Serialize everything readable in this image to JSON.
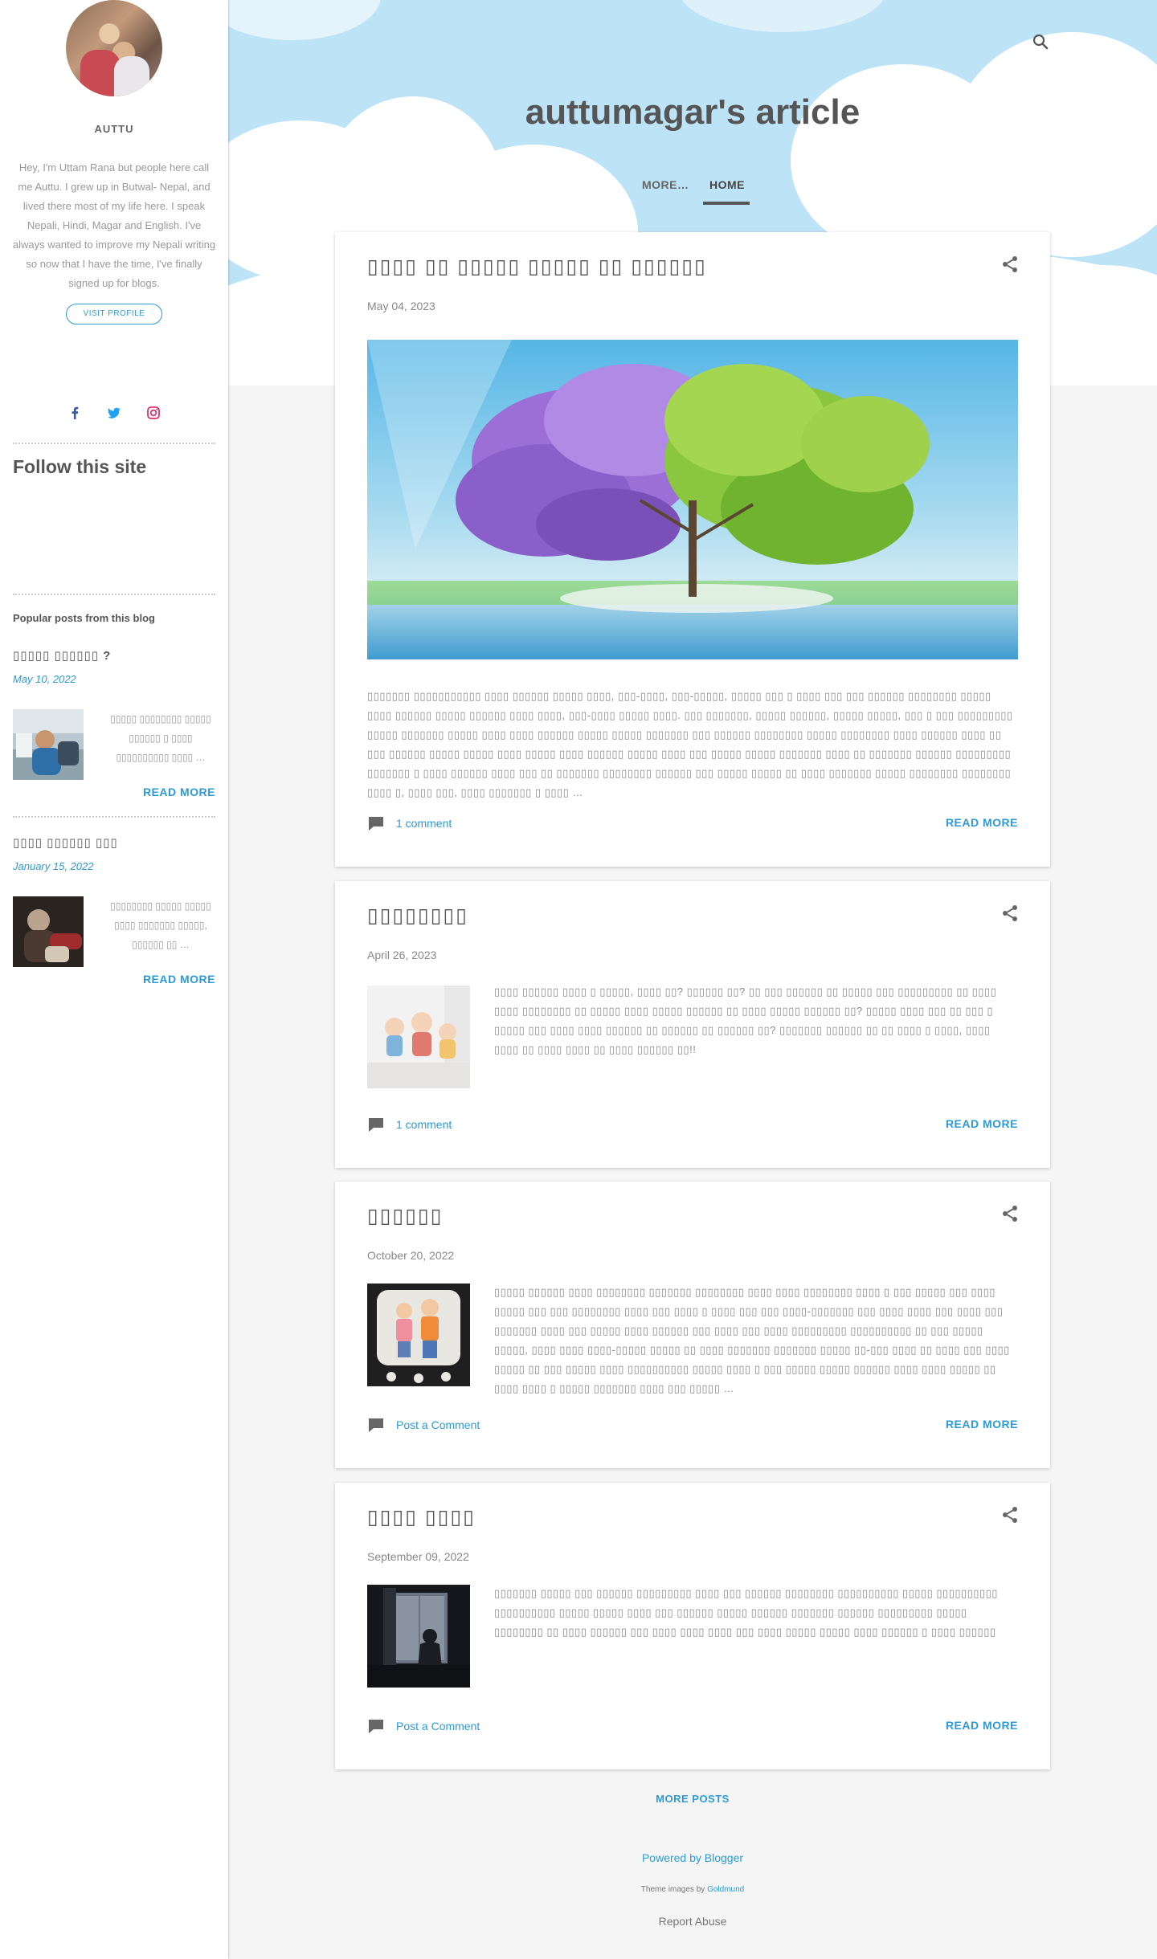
{
  "blog": {
    "title": "auttumagar's article"
  },
  "nav": {
    "more_label": "MORE…",
    "home_label": "HOME"
  },
  "profile": {
    "name": "AUTTU",
    "bio": "Hey, I'm Uttam Rana but people here call me Auttu. I grew up in Butwal- Nepal, and lived there most of my life here. I speak Nepali, Hindi, Magar and English. I've always wanted to improve my Nepali writing so now that I have the time, I've finally signed up for blogs.",
    "visit_profile_label": "VISIT PROFILE",
    "social_icons": [
      "facebook-icon",
      "twitter-icon",
      "instagram-icon"
    ]
  },
  "sidebar": {
    "follow_title": "Follow this site",
    "popular_title": "Popular posts from this blog",
    "popular_posts": [
      {
        "title": "▯▯▯▯▯ ▯▯▯▯▯▯ ?",
        "date": "May 10, 2022",
        "snippet": "▯▯▯▯▯ ▯▯▯▯▯▯▯▯ ▯▯▯▯▯ ▯▯▯▯▯▯ ▯ ▯▯▯▯ ▯▯▯▯▯▯▯▯▯▯ ▯▯▯▯ …",
        "read_more_label": "READ MORE"
      },
      {
        "title": "▯▯▯▯ ▯▯▯▯▯▯ ▯▯▯",
        "date": "January 15, 2022",
        "snippet": "▯▯▯▯▯▯▯▯ ▯▯▯▯▯ ▯▯▯▯▯ ▯▯▯▯ ▯▯▯▯▯▯▯ ▯▯▯▯▯, ▯▯▯▯▯▯ ▯▯ …",
        "read_more_label": "READ MORE"
      }
    ]
  },
  "posts": [
    {
      "title": "▯▯▯▯ ▯▯ ▯▯▯▯▯ ▯▯▯▯▯ ▯▯ ▯▯▯▯▯▯",
      "date": "May 04, 2023",
      "snippet": "▯▯▯▯▯▯▯ ▯▯▯▯▯▯▯▯▯▯▯ ▯▯▯▯ ▯▯▯▯▯▯ ▯▯▯▯▯ ▯▯▯▯, ▯▯▯-▯▯▯▯, ▯▯▯-▯▯▯▯▯, ▯▯▯▯▯ ▯▯▯ ▯ ▯▯▯▯ ▯▯▯ ▯▯▯ ▯▯▯▯▯▯ ▯▯▯▯▯▯▯▯ ▯▯▯▯▯ ▯▯▯▯ ▯▯▯▯▯▯ ▯▯▯▯▯ ▯▯▯▯▯▯ ▯▯▯▯ ▯▯▯▯, ▯▯▯-▯▯▯▯ ▯▯▯▯▯ ▯▯▯▯. ▯▯▯ ▯▯▯▯▯▯▯, ▯▯▯▯▯ ▯▯▯▯▯▯, ▯▯▯▯▯ ▯▯▯▯▯, ▯▯▯ ▯ ▯▯▯ ▯▯▯▯▯▯▯▯▯ ▯▯▯▯▯ ▯▯▯▯▯▯▯ ▯▯▯▯▯ ▯▯▯▯ ▯▯▯▯ ▯▯▯▯▯▯ ▯▯▯▯▯ ▯▯▯▯▯ ▯▯▯▯▯▯▯ ▯▯▯ ▯▯▯▯▯▯ ▯▯▯▯▯▯▯▯ ▯▯▯▯▯ ▯▯▯▯▯▯▯▯ ▯▯▯▯ ▯▯▯▯▯▯ ▯▯▯▯ ▯▯ ▯▯▯ ▯▯▯▯▯▯ ▯▯▯▯▯ ▯▯▯▯▯ ▯▯▯▯ ▯▯▯▯▯ ▯▯▯▯ ▯▯▯▯▯▯ ▯▯▯▯▯ ▯▯▯▯ ▯▯▯ ▯▯▯▯▯ ▯▯▯▯▯ ▯▯▯▯▯▯▯ ▯▯▯▯ ▯▯ ▯▯▯▯▯▯▯ ▯▯▯▯▯▯ ▯▯▯▯▯▯▯▯▯ ▯▯▯▯▯▯▯ ▯ ▯▯▯▯ ▯▯▯▯▯▯ ▯▯▯▯ ▯▯▯ ▯▯ ▯▯▯▯▯▯▯ ▯▯▯▯▯▯▯▯ ▯▯▯▯▯▯ ▯▯▯ ▯▯▯▯▯ ▯▯▯▯▯ ▯▯ ▯▯▯▯ ▯▯▯▯▯▯▯ ▯▯▯▯▯ ▯▯▯▯▯▯▯▯ ▯▯▯▯▯▯▯▯ ▯▯▯▯ ▯, ▯▯▯▯ ▯▯▯, ▯▯▯▯ ▯▯▯▯▯▯▯ ▯ ▯▯▯▯ …",
      "comments_label": "1 comment",
      "read_more_label": "READ MORE"
    },
    {
      "title": "▯▯▯▯▯▯▯▯",
      "date": "April 26, 2023",
      "snippet": "▯▯▯▯ ▯▯▯▯▯▯ ▯▯▯▯ ▯ ▯▯▯▯▯, ▯▯▯▯ ▯▯? ▯▯▯▯▯▯ ▯▯?  ▯▯ ▯▯▯ ▯▯▯▯▯▯ ▯▯ ▯▯▯▯▯ ▯▯▯ ▯▯▯▯▯▯▯▯▯ ▯▯ ▯▯▯▯ ▯▯▯▯ ▯▯▯▯▯▯▯▯ ▯▯ ▯▯▯▯▯ ▯▯▯▯ ▯▯▯▯▯ ▯▯▯▯▯▯ ▯▯ ▯▯▯▯ ▯▯▯▯▯ ▯▯▯▯▯▯ ▯▯? ▯▯▯▯▯ ▯▯▯▯ ▯▯▯ ▯▯ ▯▯▯ ▯ ▯▯▯▯▯ ▯▯▯  ▯▯▯▯ ▯▯▯▯ ▯▯▯▯▯▯ ▯▯ ▯▯▯▯▯▯ ▯▯ ▯▯▯▯▯▯ ▯▯? ▯▯▯▯▯▯▯ ▯▯▯▯▯▯ ▯▯ ▯▯ ▯▯▯▯ ▯ ▯▯▯▯,  ▯▯▯▯ ▯▯▯▯ ▯▯ ▯▯▯▯ ▯▯▯▯ ▯▯ ▯▯▯▯ ▯▯▯▯▯▯ ▯▯!!",
      "comments_label": "1 comment",
      "read_more_label": "READ MORE"
    },
    {
      "title": "▯▯▯▯▯▯",
      "date": "October 20, 2022",
      "snippet": "▯▯▯▯▯ ▯▯▯▯▯▯ ▯▯▯▯ ▯▯▯▯▯▯▯▯ ▯▯▯▯▯▯▯ ▯▯▯▯▯▯▯▯ ▯▯▯▯ ▯▯▯▯ ▯▯▯▯▯▯▯▯ ▯▯▯▯ ▯ ▯▯▯ ▯▯▯▯▯ ▯▯▯ ▯▯▯▯ ▯▯▯▯▯ ▯▯▯ ▯▯▯ ▯▯▯▯▯▯▯▯ ▯▯▯▯ ▯▯▯ ▯▯▯▯ ▯ ▯▯▯▯ ▯▯▯ ▯▯▯ ▯▯▯▯-▯▯▯▯▯▯▯ ▯▯▯ ▯▯▯▯ ▯▯▯▯ ▯▯▯ ▯▯▯▯ ▯▯▯ ▯▯▯▯▯▯▯ ▯▯▯▯ ▯▯▯ ▯▯▯▯▯ ▯▯▯▯ ▯▯▯▯▯▯ ▯▯▯ ▯▯▯▯ ▯▯▯ ▯▯▯▯ ▯▯▯▯▯▯▯▯▯ ▯▯▯▯▯▯▯▯▯▯ ▯▯ ▯▯▯ ▯▯▯▯▯ ▯▯▯▯▯, ▯▯▯▯ ▯▯▯▯ ▯▯▯▯-▯▯▯▯▯ ▯▯▯▯▯ ▯▯ ▯▯▯▯ ▯▯▯▯▯▯▯ ▯▯▯▯▯▯▯ ▯▯▯▯▯ ▯▯-▯▯▯ ▯▯▯▯ ▯▯ ▯▯▯▯ ▯▯▯ ▯▯▯▯ ▯▯▯▯▯ ▯▯ ▯▯▯ ▯▯▯▯▯ ▯▯▯▯ ▯▯▯▯▯▯▯▯▯▯   ▯▯▯▯▯ ▯▯▯▯ ▯ ▯▯▯ ▯▯▯▯▯ ▯▯▯▯▯ ▯▯▯▯▯▯ ▯▯▯▯ ▯▯▯▯ ▯▯▯▯▯ ▯▯ ▯▯▯▯ ▯▯▯▯ ▯ ▯▯▯▯▯ ▯▯▯▯▯▯▯ ▯▯▯▯ ▯▯▯ ▯▯▯▯▯ …",
      "comments_label": "Post a Comment",
      "read_more_label": "READ MORE"
    },
    {
      "title": "▯▯▯▯ ▯▯▯▯",
      "date": "September 09, 2022",
      "snippet": "▯▯▯▯▯▯▯ ▯▯▯▯▯ ▯▯▯ ▯▯▯▯▯▯ ▯▯▯▯▯▯▯▯▯ ▯▯▯▯ ▯▯▯ ▯▯▯▯▯▯ ▯▯▯▯▯▯▯▯ ▯▯▯▯▯▯▯▯▯▯ ▯▯▯▯▯ ▯▯▯▯▯▯▯▯▯▯ ▯▯▯▯▯▯▯▯▯▯ ▯▯▯▯▯ ▯▯▯▯▯ ▯▯▯▯ ▯▯▯ ▯▯▯▯▯▯ ▯▯▯▯▯ ▯▯▯▯▯▯ ▯▯▯▯▯▯▯ ▯▯▯▯▯▯ ▯▯▯▯▯▯▯▯▯ ▯▯▯▯▯ ▯▯▯▯▯▯▯▯ ▯▯ ▯▯▯▯ ▯▯▯▯▯▯ ▯▯▯ ▯▯▯▯ ▯▯▯▯ ▯▯▯▯ ▯▯▯ ▯▯▯▯ ▯▯▯▯▯ ▯▯▯▯▯ ▯▯▯▯ ▯▯▯▯▯▯ ▯ ▯▯▯▯ ▯▯▯▯▯▯",
      "comments_label": "Post a Comment",
      "read_more_label": "READ MORE"
    }
  ],
  "footer": {
    "more_posts_label": "MORE POSTS",
    "powered_by": "Powered by Blogger",
    "theme_prefix": "Theme images by",
    "theme_author": "Goldmund",
    "report_abuse": "Report Abuse"
  },
  "colors": {
    "accent": "#2d9ad9",
    "header_sky": "#bde3f7",
    "background": "#f5f5f5"
  }
}
